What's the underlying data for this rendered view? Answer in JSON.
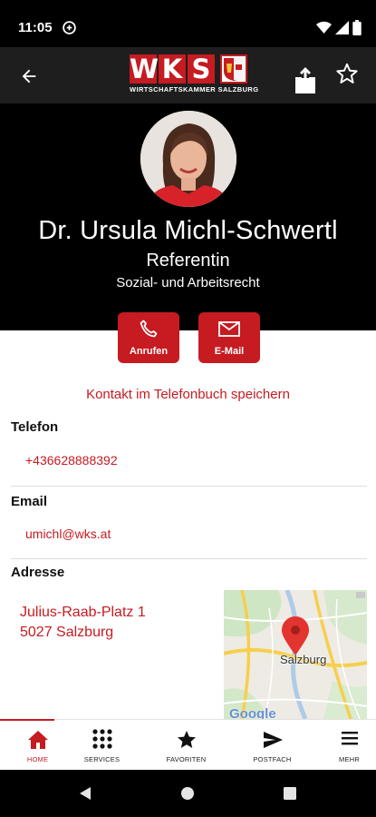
{
  "status_bar": {
    "time": "11:05"
  },
  "app_bar": {
    "logo_letters": [
      "W",
      "K",
      "S"
    ],
    "logo_subtitle": "WIRTSCHAFTSKAMMER SALZBURG"
  },
  "contact": {
    "name": "Dr. Ursula Michl-Schwertl",
    "role": "Referentin",
    "department": "Sozial- und Arbeitsrecht"
  },
  "actions": {
    "call_label": "Anrufen",
    "email_label": "E-Mail"
  },
  "save_contact_label": "Kontakt im Telefonbuch speichern",
  "phone": {
    "label": "Telefon",
    "value": "+436628888392"
  },
  "email": {
    "label": "Email",
    "value": "umichl@wks.at"
  },
  "address": {
    "label": "Adresse",
    "street": "Julius-Raab-Platz 1",
    "city": "5027 Salzburg",
    "map_label": "Salzburg",
    "map_brand": "Google"
  },
  "bottom_nav": [
    {
      "label": "HOME",
      "icon": "home-icon",
      "active": true
    },
    {
      "label": "SERVICES",
      "icon": "grid-icon",
      "active": false
    },
    {
      "label": "FAVORITEN",
      "icon": "star-icon",
      "active": false
    },
    {
      "label": "POSTFACH",
      "icon": "send-icon",
      "active": false
    },
    {
      "label": "MEHR",
      "icon": "menu-icon",
      "active": false
    }
  ],
  "colors": {
    "accent": "#c61b21",
    "header_bg": "#000000",
    "appbar_bg": "#1e1e1e"
  }
}
